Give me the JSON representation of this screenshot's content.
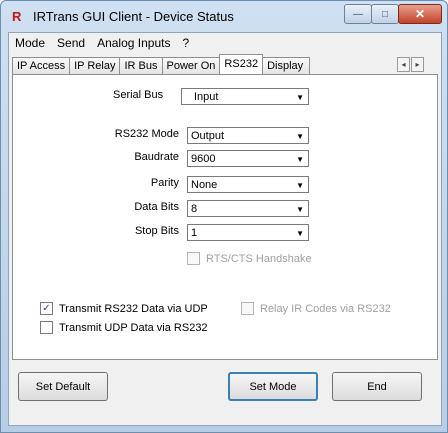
{
  "window": {
    "title": "IRTrans GUI Client - Device Status",
    "min_glyph": "—",
    "max_glyph": "□",
    "close_glyph": "✕",
    "icon_glyph": "R"
  },
  "menu": [
    "Mode",
    "Send",
    "Analog Inputs",
    "?"
  ],
  "tabs": [
    "IP Access",
    "IP Relay",
    "IR Bus",
    "Power On",
    "RS232",
    "Display"
  ],
  "active_tab": "RS232",
  "tab_scroll": {
    "left": "◂",
    "right": "▸"
  },
  "form": {
    "serial_bus": {
      "label": "Serial Bus",
      "value": "Input",
      "cut_glyph": "?"
    },
    "rs232_mode": {
      "label": "RS232 Mode",
      "value": "Output"
    },
    "baudrate": {
      "label": "Baudrate",
      "value": "9600"
    },
    "parity": {
      "label": "Parity",
      "value": "None"
    },
    "data_bits": {
      "label": "Data Bits",
      "value": "8"
    },
    "stop_bits": {
      "label": "Stop Bits",
      "value": "1"
    },
    "rts_cts": {
      "label": "RTS/CTS Handshake",
      "checked": false,
      "enabled": false
    },
    "transmit_rs232_udp": {
      "label": "Transmit RS232 Data via UDP",
      "checked": true
    },
    "relay_ir_codes": {
      "label": "Relay IR Codes via RS232",
      "checked": false,
      "enabled": false
    },
    "transmit_udp_rs232": {
      "label": "Transmit UDP Data via RS232",
      "checked": false
    }
  },
  "buttons": {
    "set_default": "Set Default",
    "set_mode": "Set Mode",
    "end": "End"
  },
  "glyphs": {
    "dropdown": "▼",
    "check": "✓"
  }
}
